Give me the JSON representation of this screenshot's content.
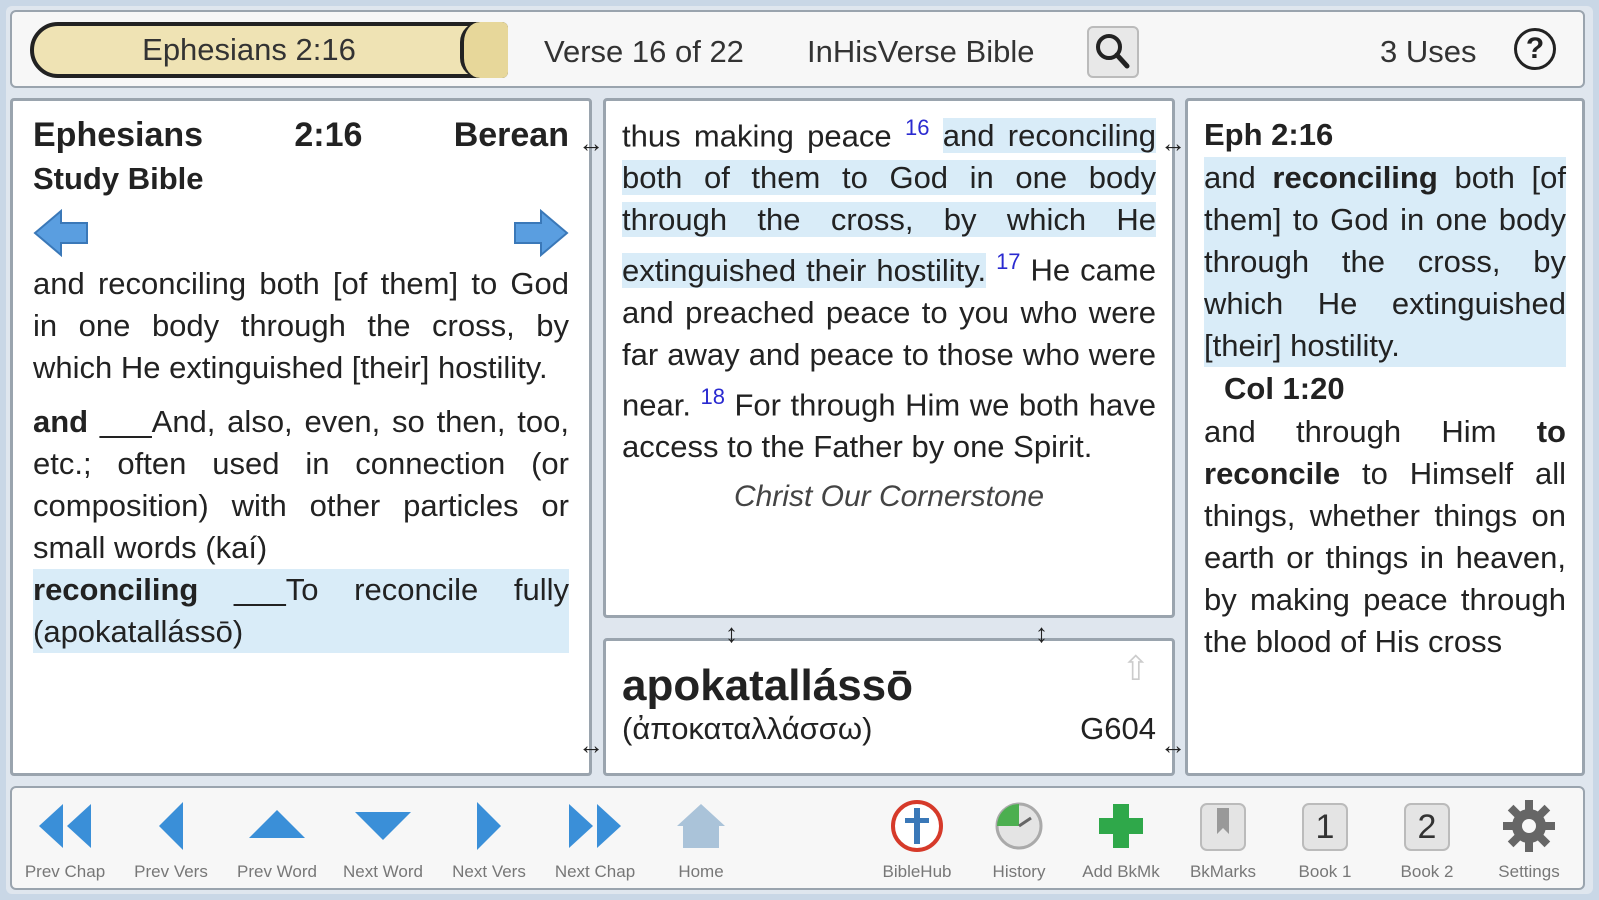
{
  "header": {
    "reference": "Ephesians 2:16",
    "verse_position": "Verse 16 of 22",
    "bible_name": "InHisVerse Bible",
    "uses": "3 Uses",
    "help": "?"
  },
  "left_panel": {
    "book": "Ephesians",
    "ref": "2:16",
    "version_1": "Berean",
    "version_2": "Study Bible",
    "verse_text": "and reconciling both [of them] to God in one body through the cross, by which He extinguished [their] hostility.",
    "word1": {
      "term": "and",
      "blank": "___",
      "def": "And, also, even, so then, too, etc.; often used in connection (or composition) with other particles or small words (kaí)"
    },
    "word2": {
      "term": "reconciling",
      "blank": "___",
      "def": "To reconcile fully (apokatallássō)"
    }
  },
  "middle_panel": {
    "lead": "thus making peace",
    "v16_num": "16",
    "v16": "and reconciling both of them to God in one body through the cross, by which He extinguished their hostility.",
    "v17_num": "17",
    "v17": "He came and preached peace to you who were far away and peace to those who were near.",
    "v18_num": "18",
    "v18": "For through Him we both have access to the Father by one Spirit.",
    "heading": "Christ Our Cornerstone"
  },
  "word_panel": {
    "word": "apokatallássō",
    "greek": "(ἀποκαταλλάσσω)",
    "strongs": "G604"
  },
  "right_panel": {
    "ref1": "Eph 2:16",
    "t1a": "and",
    "t1b": "reconciling",
    "t1c": "both [of them] to God in one body through the cross, by which He extinguished [their] hostility.",
    "ref2": "Col 1:20",
    "t2a": "and through Him",
    "t2b": "to reconcile",
    "t2c": "to Himself all things, whether things on earth or things in heaven, by making peace through the blood of His cross"
  },
  "toolbar": {
    "prev_chap": "Prev Chap",
    "prev_vers": "Prev Vers",
    "prev_word": "Prev Word",
    "next_word": "Next Word",
    "next_vers": "Next Vers",
    "next_chap": "Next Chap",
    "home": "Home",
    "biblehub": "BibleHub",
    "history": "History",
    "add_bkmk": "Add BkMk",
    "bkmarks": "BkMarks",
    "book1": "Book 1",
    "book1_num": "1",
    "book2": "Book 2",
    "book2_num": "2",
    "settings": "Settings"
  },
  "colors": {
    "highlight": "#d9ecf8",
    "accent_blue": "#3a8fd8",
    "verse_num": "#2a2ad0"
  }
}
